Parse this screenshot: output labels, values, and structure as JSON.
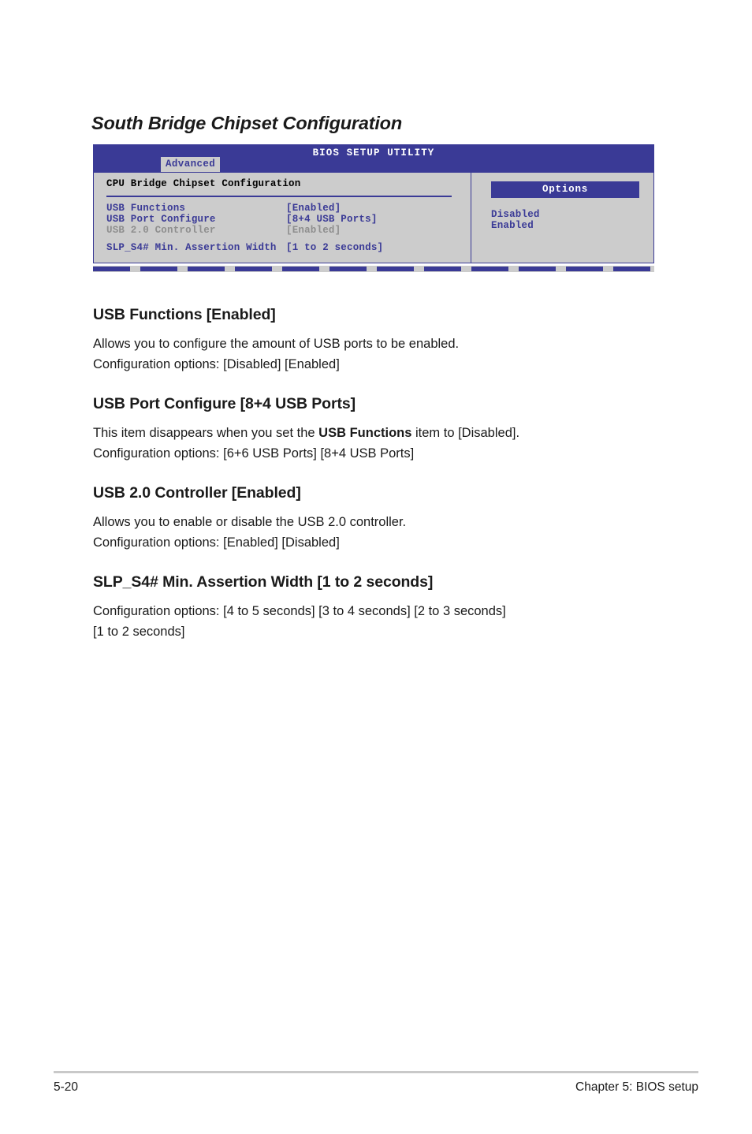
{
  "section": {
    "title": "South Bridge Chipset Configuration"
  },
  "bios": {
    "utility_title": "BIOS SETUP UTILITY",
    "active_tab": "Advanced",
    "panel_heading": "CPU Bridge Chipset Configuration",
    "rows": [
      {
        "label": "USB Functions",
        "value": "[Enabled]"
      },
      {
        "label": "USB Port Configure",
        "value": "[8+4 USB Ports]"
      },
      {
        "label": "USB 2.0 Controller",
        "value": "[Enabled]"
      },
      {
        "label": "SLP_S4# Min. Assertion Width",
        "value": "[1 to 2 seconds]"
      }
    ],
    "options": {
      "header": "Options",
      "items": [
        "Disabled",
        "Enabled"
      ]
    },
    "colors": {
      "header_blue": "#3a3a96",
      "panel_gray": "#cccccc",
      "dim_text": "#8e8e8e",
      "white": "#ffffff"
    }
  },
  "content": {
    "items": [
      {
        "heading": "USB Functions [Enabled]",
        "lines": [
          "Allows you to configure the amount of USB ports to be enabled.",
          "Configuration options: [Disabled] [Enabled]"
        ]
      },
      {
        "heading": "USB Port Configure [8+4 USB Ports]",
        "line1_pre": "This item disappears when you set the ",
        "line1_bold": "USB Functions",
        "line1_post": " item to [Disabled].",
        "line2": "Configuration options: [6+6 USB Ports] [8+4 USB Ports]"
      },
      {
        "heading": "USB 2.0 Controller [Enabled]",
        "lines": [
          "Allows you to enable or disable the USB 2.0 controller.",
          "Configuration options: [Enabled] [Disabled]"
        ]
      },
      {
        "heading": "SLP_S4# Min. Assertion Width [1 to 2 seconds]",
        "lines": [
          "Configuration options: [4 to 5 seconds] [3 to 4 seconds] [2 to 3 seconds]",
          "[1 to 2 seconds]"
        ]
      }
    ]
  },
  "footer": {
    "page_number": "5-20",
    "chapter": "Chapter 5: BIOS setup"
  }
}
